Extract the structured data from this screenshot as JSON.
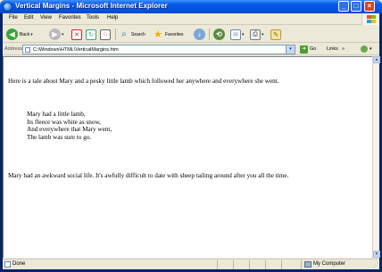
{
  "window": {
    "title": "Vertical Margins - Microsoft Internet Explorer",
    "controls": {
      "minimize": "_",
      "maximize": "□",
      "close": "×"
    }
  },
  "menubar": {
    "items": [
      "File",
      "Edit",
      "View",
      "Favorites",
      "Tools",
      "Help"
    ]
  },
  "toolbar": {
    "back_label": "Back",
    "search_label": "Search",
    "favorites_label": "Favorites",
    "icons": [
      "back-icon",
      "forward-icon",
      "stop-icon",
      "refresh-icon",
      "home-icon",
      "search-icon",
      "favorites-icon",
      "media-icon",
      "history-icon",
      "mail-icon",
      "print-icon",
      "edit-icon"
    ]
  },
  "addressbar": {
    "label": "Address",
    "url": "C:\\Windows\\HTML\\VerticalMargins.htm",
    "go_label": "Go",
    "links_label": "Links",
    "links_arrow": "»"
  },
  "content": {
    "paragraph1": "Here is a tale about Mary and a pesky little lamb which followed her anywhere and everywhere she went.",
    "poem_lines": [
      "Mary had a little lamb,",
      "Its fleece was white as snow,",
      "And everywhere that Mary went,",
      "The lamb was sure to go."
    ],
    "paragraph2": "Mary had an awkward social life. It's awfully difficult to date with sheep tailing around after you all the time."
  },
  "statusbar": {
    "status": "Done",
    "zone": "My Computer"
  },
  "colors": {
    "titlebar": "#0054e3",
    "close": "#d9431f",
    "content_bg": "#ffffff",
    "chrome": "#ece9d8"
  }
}
